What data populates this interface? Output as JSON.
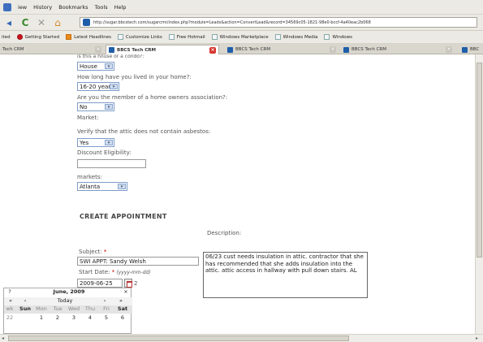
{
  "menu": {
    "items": [
      "iew",
      "History",
      "Bookmarks",
      "Tools",
      "Help"
    ]
  },
  "nav": {
    "url": "http://sugar.bbcstech.com/sugarcrm/index.php?module=Leads&action=ConvertLead&record=34569c05-1821-98e0-bccf-4a40eac2b068"
  },
  "bookmarks": [
    "ited",
    "Getting Started",
    "Latest Headlines",
    "Customize Links",
    "Free Hotmail",
    "Windows Marketplace",
    "Windows Media",
    "Windows"
  ],
  "tabs": [
    "Tech CRM",
    "BBCS Tech CRM",
    "BBCS Tech CRM",
    "BBCS Tech CRM",
    "BBC"
  ],
  "form": {
    "q0_partial": "is this a house or a condo?:",
    "q0_value": "House",
    "q1": "How long have you lived in your home?:",
    "q1_value": "16-20 years",
    "q2": "Are you the member of a home owners association?:",
    "q2_value": "No",
    "q3": "Market:",
    "q4": "Verify that the attic does not contain asbestos:",
    "q4_value": "Yes",
    "q5": "Discount Eligibility:",
    "q6": "markets:",
    "q6_value": "Atlanta"
  },
  "appointment": {
    "heading": "CREATE APPOINTMENT",
    "description_label": "Description:",
    "subject_label": "Subject:",
    "subject_required": "*",
    "subject_value": "SWI APPT: Sandy  Welsh",
    "start_label": "Start Date:",
    "start_required": "*",
    "start_format": "(yyyy-mm-dd)",
    "start_value": "2009-06-25",
    "description_value": "06/23 cust needs insulation in attic. contractor that she has recommended that she adds insulation into the attic. attic access in hallway with pull down stairs. AL",
    "trailing_fragment": "2"
  },
  "calendar": {
    "help": "?",
    "month_year": "June, 2009",
    "close": "×",
    "prev_year": "«",
    "prev_month": "‹",
    "today": "Today",
    "next_month": "›",
    "next_year": "»",
    "week_header": "wk",
    "days": [
      "Sun",
      "Mon",
      "Tue",
      "Wed",
      "Thu",
      "Fri",
      "Sat"
    ],
    "week_number": "22",
    "dates": [
      "",
      "1",
      "2",
      "3",
      "4",
      "5",
      "6"
    ]
  }
}
